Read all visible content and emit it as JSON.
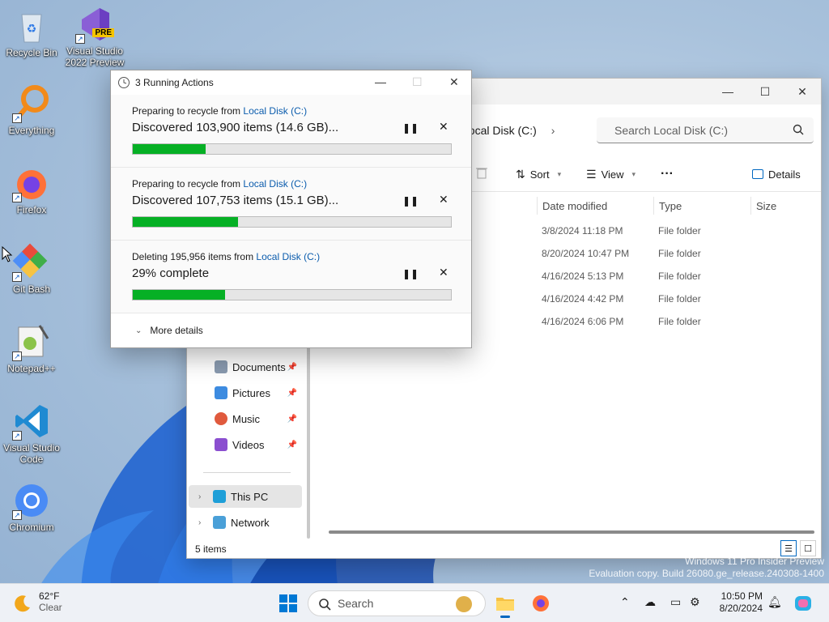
{
  "desktop": {
    "icons": [
      {
        "label": "Recycle Bin",
        "icon": "recycle-bin-icon"
      },
      {
        "label": "Visual Studio 2022 Preview",
        "badge": "PRE",
        "icon": "visual-studio-icon"
      },
      {
        "label": "Everything",
        "icon": "everything-icon"
      },
      {
        "label": "Firefox",
        "icon": "firefox-icon"
      },
      {
        "label": "Git Bash",
        "icon": "git-bash-icon"
      },
      {
        "label": "Notepad++",
        "icon": "notepad-plus-plus-icon"
      },
      {
        "label": "Visual Studio Code",
        "icon": "vscode-icon"
      },
      {
        "label": "Chromium",
        "icon": "chromium-icon"
      }
    ]
  },
  "explorer": {
    "address_segment": "Local Disk (C:)",
    "search_placeholder": "Search Local Disk (C:)",
    "toolbar": {
      "sort": "Sort",
      "view": "View",
      "more": "···",
      "details": "Details"
    },
    "columns": {
      "date": "Date modified",
      "type": "Type",
      "size": "Size"
    },
    "rows": [
      {
        "date": "3/8/2024 11:18 PM",
        "type": "File folder"
      },
      {
        "date": "8/20/2024 10:47 PM",
        "type": "File folder"
      },
      {
        "date": "4/16/2024 5:13 PM",
        "type": "File folder"
      },
      {
        "date": "4/16/2024 4:42 PM",
        "type": "File folder"
      },
      {
        "date": "4/16/2024 6:06 PM",
        "type": "File folder"
      }
    ],
    "nav": {
      "documents": "Documents",
      "pictures": "Pictures",
      "music": "Music",
      "videos": "Videos",
      "this_pc": "This PC",
      "network": "Network"
    },
    "status": "5 items"
  },
  "dialog": {
    "title": "3 Running Actions",
    "operations": [
      {
        "prefix": "Preparing to recycle from",
        "link": "Local Disk (C:)",
        "main": "Discovered 103,900 items (14.6 GB)...",
        "progress": 0.23
      },
      {
        "prefix": "Preparing to recycle from",
        "link": "Local Disk (C:)",
        "main": "Discovered 107,753 items (15.1 GB)...",
        "progress": 0.33
      },
      {
        "prefix": "Deleting 195,956 items from",
        "link": "Local Disk (C:)",
        "main": "29% complete",
        "progress": 0.29
      }
    ],
    "more_details": "More details"
  },
  "watermark": {
    "line1": "Windows 11 Pro Insider Preview",
    "line2": "Evaluation copy. Build 26080.ge_release.240308-1400"
  },
  "taskbar": {
    "weather_temp": "62°F",
    "weather_cond": "Clear",
    "search_label": "Search",
    "time": "10:50 PM",
    "date": "8/20/2024"
  },
  "colors": {
    "progress_fill": "#06b025",
    "link": "#0b5cad",
    "accent": "#0067c0"
  }
}
